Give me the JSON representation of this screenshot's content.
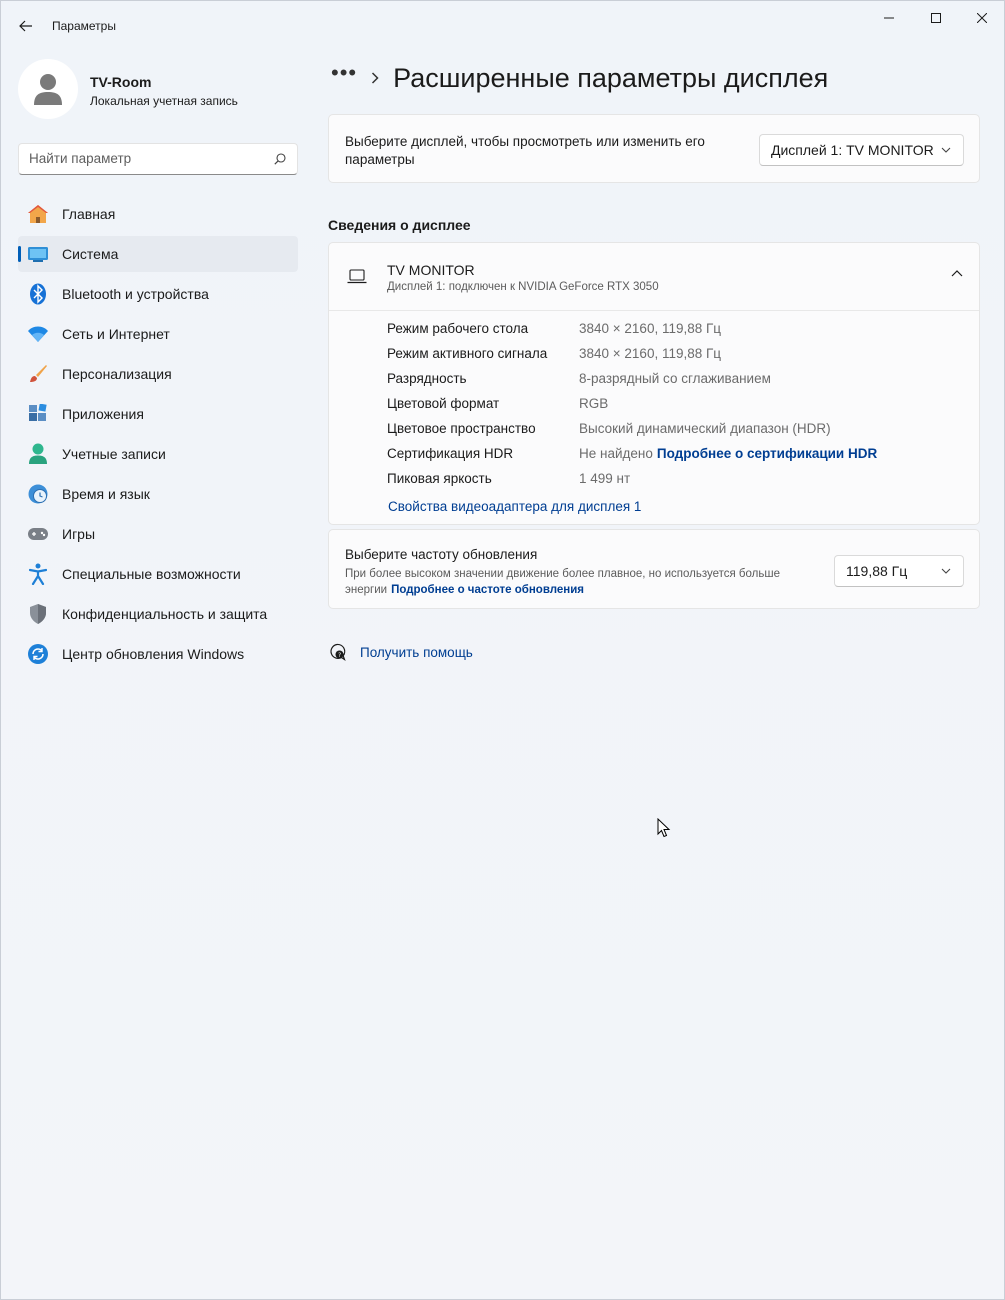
{
  "window": {
    "title": "Параметры"
  },
  "profile": {
    "name": "TV-Room",
    "account_type": "Локальная учетная запись"
  },
  "search": {
    "placeholder": "Найти параметр"
  },
  "sidebar": {
    "items": [
      {
        "label": "Главная",
        "icon": "home-icon"
      },
      {
        "label": "Система",
        "icon": "system-icon",
        "active": true
      },
      {
        "label": "Bluetooth и устройства",
        "icon": "bluetooth-icon"
      },
      {
        "label": "Сеть и Интернет",
        "icon": "wifi-icon"
      },
      {
        "label": "Персонализация",
        "icon": "brush-icon"
      },
      {
        "label": "Приложения",
        "icon": "apps-icon"
      },
      {
        "label": "Учетные записи",
        "icon": "person-icon"
      },
      {
        "label": "Время и язык",
        "icon": "clock-globe-icon"
      },
      {
        "label": "Игры",
        "icon": "gamepad-icon"
      },
      {
        "label": "Специальные возможности",
        "icon": "accessibility-icon"
      },
      {
        "label": "Конфиденциальность и защита",
        "icon": "shield-icon"
      },
      {
        "label": "Центр обновления Windows",
        "icon": "update-icon"
      }
    ]
  },
  "breadcrumb": {
    "more": "•••",
    "page_title": "Расширенные параметры дисплея"
  },
  "display_select": {
    "label": "Выберите дисплей, чтобы просмотреть или изменить его параметры",
    "selected": "Дисплей 1: TV MONITOR"
  },
  "display_info": {
    "section_title": "Сведения о дисплее",
    "monitor_name": "TV MONITOR",
    "monitor_sub": "Дисплей 1: подключен к NVIDIA GeForce RTX 3050",
    "rows": [
      {
        "key": "Режим рабочего стола",
        "value": "3840 × 2160, 119,88 Гц"
      },
      {
        "key": "Режим активного сигнала",
        "value": "3840 × 2160, 119,88 Гц"
      },
      {
        "key": "Разрядность",
        "value": "8-разрядный со сглаживанием"
      },
      {
        "key": "Цветовой формат",
        "value": "RGB"
      },
      {
        "key": "Цветовое пространство",
        "value": "Высокий динамический диапазон (HDR)"
      },
      {
        "key": "Сертификация HDR",
        "value": "Не найдено",
        "link": "Подробнее о сертификации HDR"
      },
      {
        "key": "Пиковая яркость",
        "value": "1 499 нт"
      }
    ],
    "adapter_link": "Свойства видеоадаптера для дисплея 1"
  },
  "refresh": {
    "title": "Выберите частоту обновления",
    "description": "При более высоком значении движение более плавное, но используется больше энергии",
    "link": "Подробнее о частоте обновления",
    "selected": "119,88 Гц"
  },
  "help": {
    "label": "Получить помощь"
  },
  "colors": {
    "accent": "#005fb8",
    "link": "#003e92"
  }
}
